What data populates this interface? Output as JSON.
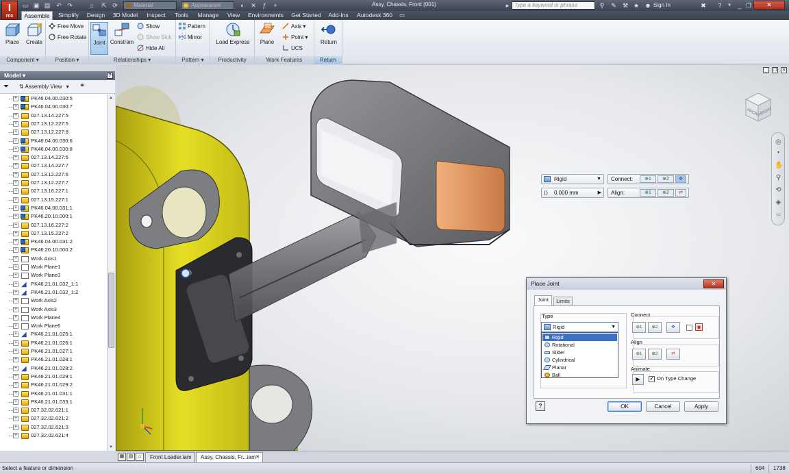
{
  "app": {
    "logo_letter": "I",
    "logo_sub": "PRO",
    "window_title": "Assy, Chassis, Front (001)",
    "search_placeholder": "Type a keyword or phrase",
    "sign_in": "Sign In"
  },
  "quick_access": {
    "material": "Material",
    "appearance": "Appearance"
  },
  "ribbon_tabs": [
    "Assemble",
    "Simplify",
    "Design",
    "3D Model",
    "Inspect",
    "Tools",
    "Manage",
    "View",
    "Environments",
    "Get Started",
    "Add-Ins",
    "Autodesk 360"
  ],
  "ribbon": {
    "component": {
      "label": "Component",
      "place": "Place",
      "create": "Create"
    },
    "position": {
      "label": "Position",
      "free_move": "Free Move",
      "free_rotate": "Free Rotate"
    },
    "relationships": {
      "label": "Relationships",
      "joint": "Joint",
      "constrain": "Constrain",
      "show": "Show",
      "show_sick": "Show Sick",
      "hide_all": "Hide All"
    },
    "pattern": {
      "label": "Pattern",
      "pattern": "Pattern",
      "mirror": "Mirror"
    },
    "productivity": {
      "label": "Productivity",
      "load_express": "Load Express"
    },
    "work_features": {
      "label": "Work Features",
      "plane": "Plane",
      "axis": "Axis",
      "point": "Point",
      "ucs": "UCS"
    },
    "return": {
      "label": "Return",
      "return": "Return"
    }
  },
  "browser": {
    "title": "Model",
    "view_mode": "Assembly View",
    "items": [
      {
        "icon": "asm",
        "label": "PK46.04.00.030:5"
      },
      {
        "icon": "asm",
        "label": "PK46.04.00.030:7"
      },
      {
        "icon": "part",
        "label": "027.13.14.227:5"
      },
      {
        "icon": "part",
        "label": "027.13.12.227:5"
      },
      {
        "icon": "part",
        "label": "027.13.12.227:8"
      },
      {
        "icon": "asm",
        "label": "PK46.04.00.030:6"
      },
      {
        "icon": "asm",
        "label": "PK46.04.00.030:8"
      },
      {
        "icon": "part",
        "label": "027.13.14.227:6"
      },
      {
        "icon": "part",
        "label": "027.13.14.227:7"
      },
      {
        "icon": "part",
        "label": "027.13.12.227:6"
      },
      {
        "icon": "part",
        "label": "027.13.12.227:7"
      },
      {
        "icon": "part",
        "label": "027.13.16.227:1"
      },
      {
        "icon": "part",
        "label": "027.13.15.227:1"
      },
      {
        "icon": "asm",
        "label": "PK46.04.00.031:1"
      },
      {
        "icon": "asm",
        "label": "PK46.20.10.000:1"
      },
      {
        "icon": "part",
        "label": "027.13.16.227:2"
      },
      {
        "icon": "part",
        "label": "027.13.15.227:2"
      },
      {
        "icon": "asm",
        "label": "PK46.04.00.031:2"
      },
      {
        "icon": "asm",
        "label": "PK46.20.10.000:2"
      },
      {
        "icon": "work",
        "label": "Work Axis1"
      },
      {
        "icon": "work",
        "label": "Work Plane1"
      },
      {
        "icon": "work",
        "label": "Work Plane3"
      },
      {
        "icon": "joint",
        "label": "PK46.21.01.032_1:1"
      },
      {
        "icon": "joint",
        "label": "PK46.21.01.032_1:2"
      },
      {
        "icon": "work",
        "label": "Work Axis2"
      },
      {
        "icon": "work",
        "label": "Work Axis3"
      },
      {
        "icon": "work",
        "label": "Work Plane4"
      },
      {
        "icon": "work",
        "label": "Work Plane6"
      },
      {
        "icon": "joint",
        "label": "PK46.21.01.025:1"
      },
      {
        "icon": "part",
        "label": "PK46.21.01.026:1"
      },
      {
        "icon": "part",
        "label": "PK46.21.01.027:1"
      },
      {
        "icon": "part",
        "label": "PK46.21.01.028:1"
      },
      {
        "icon": "joint",
        "label": "PK46.21.01.028:2"
      },
      {
        "icon": "part",
        "label": "PK46.21.01.029:1"
      },
      {
        "icon": "part",
        "label": "PK46.21.01.029:2"
      },
      {
        "icon": "part",
        "label": "PK46.21.01.031:1"
      },
      {
        "icon": "part",
        "label": "PK46.21.01.033:1"
      },
      {
        "icon": "part",
        "label": "027.32.02.621:1"
      },
      {
        "icon": "part",
        "label": "027.32.02.621:2"
      },
      {
        "icon": "part",
        "label": "027.32.02.621:3"
      },
      {
        "icon": "part",
        "label": "027.32.02.621:4"
      }
    ]
  },
  "viewcube": {
    "front": "FRONT",
    "right": "RIGHT"
  },
  "mini_toolbar": {
    "joint_type": "Rigid",
    "offset": "0.000 mm",
    "connect_label": "Connect:",
    "align_label": "Align:",
    "btn1": "1",
    "btn2": "2"
  },
  "dialog": {
    "title": "Place Joint",
    "tabs": [
      "Joint",
      "Limits"
    ],
    "type_label": "Type",
    "type_value": "Rigid",
    "type_options": [
      "Rigid",
      "Rotational",
      "Slider",
      "Cylindrical",
      "Planar",
      "Ball"
    ],
    "connect_label": "Connect",
    "align_label": "Align",
    "animate_label": "Animate",
    "on_type_change": "On Type Change",
    "on_type_change_checked": true,
    "ok": "OK",
    "cancel": "Cancel",
    "apply": "Apply",
    "btn1": "1",
    "btn2": "2"
  },
  "doc_tabs": {
    "tabs": [
      "Front Loader.iam",
      "Assy, Chassis, Fr...iam"
    ],
    "active": 1
  },
  "status": {
    "message": "Select a feature or dimension",
    "value1": "604",
    "value2": "1738"
  },
  "colors": {
    "titlebar": "#3c4452",
    "ribbon_active_tab": "#f7f9fc",
    "selection": "#3d6fc2",
    "yellow_part": "#d9d21a",
    "orange_face": "#e0915a"
  }
}
